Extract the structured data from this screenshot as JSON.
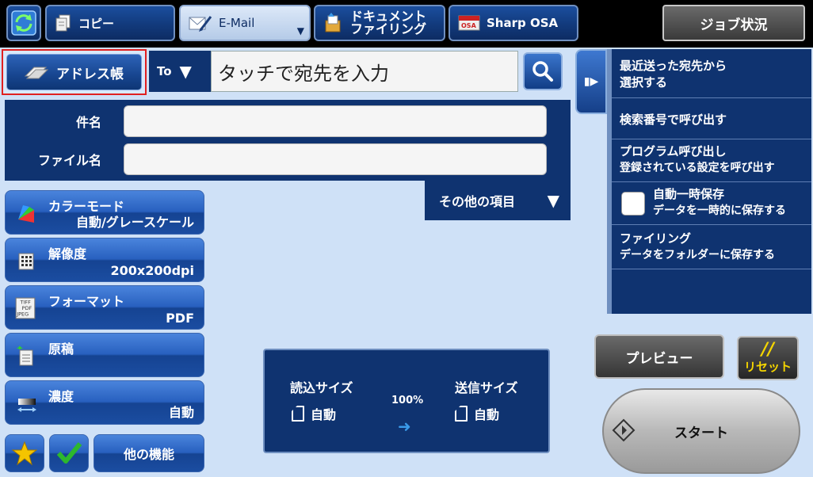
{
  "topbar": {
    "tabs": [
      {
        "label": "コピー",
        "icon": "copy-icon"
      },
      {
        "label": "E-Mail",
        "icon": "email-icon",
        "active": true
      },
      {
        "label_line1": "ドキュメント",
        "label_line2": "ファイリング",
        "icon": "document-filing-icon"
      },
      {
        "label": "Sharp OSA",
        "icon": "osa-icon"
      }
    ],
    "job_status": "ジョブ状況"
  },
  "address": {
    "book_label": "アドレス帳",
    "to_label": "To",
    "dest_placeholder": "タッチで宛先を入力"
  },
  "fields": {
    "subject_label": "件名",
    "subject_value": "",
    "filename_label": "ファイル名",
    "filename_value": "",
    "other_items": "その他の項目"
  },
  "functions": [
    {
      "title": "カラーモード",
      "value": "自動/グレースケール",
      "icon": "color-mode-icon"
    },
    {
      "title": "解像度",
      "value": "200x200dpi",
      "icon": "resolution-icon"
    },
    {
      "title": "フォーマット",
      "value": "PDF",
      "icon": "format-icon",
      "icon_text": [
        "TIFF",
        "PDF",
        "JPEG"
      ]
    },
    {
      "title": "原稿",
      "value": "",
      "icon": "original-icon"
    },
    {
      "title": "濃度",
      "value": "自動",
      "icon": "exposure-icon"
    }
  ],
  "bottom_left": {
    "other_functions": "他の機能"
  },
  "size_panel": {
    "scan_label": "読込サイズ",
    "scan_value": "自動",
    "ratio": "100%",
    "send_label": "送信サイズ",
    "send_value": "自動"
  },
  "right_panel": {
    "items": [
      {
        "line1": "最近送った宛先から",
        "line2": "選択する"
      },
      {
        "line1": "検索番号で呼び出す"
      },
      {
        "line1": "プログラム呼び出し",
        "line2": "登録されている設定を呼び出す"
      },
      {
        "line1": "自動一時保存",
        "line2": "データを一時的に保存する"
      },
      {
        "line1": "ファイリング",
        "line2": "データをフォルダーに保存する"
      }
    ]
  },
  "actions": {
    "preview": "プレビュー",
    "reset_symbol": "//",
    "reset": "リセット",
    "start": "スタート"
  },
  "colors": {
    "panel_navy": "#0f3370",
    "background": "#cfe1f7",
    "highlight_red": "#e02020",
    "reset_yellow": "#f5d500"
  }
}
